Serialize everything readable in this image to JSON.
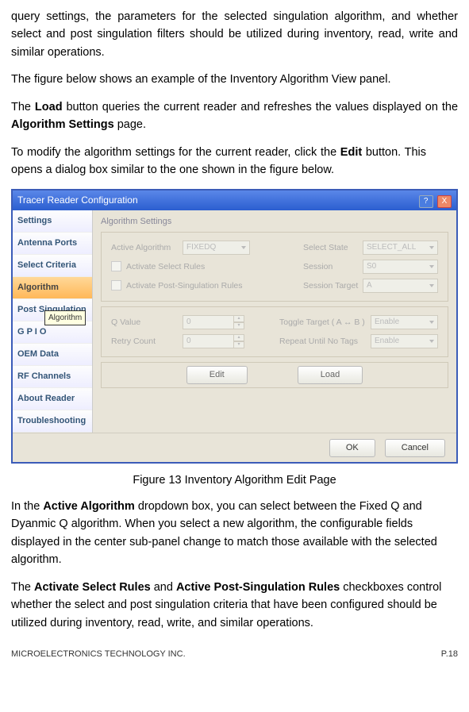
{
  "para1": "query settings, the parameters for the selected singulation algorithm, and whether select and post singulation filters should be utilized during inventory, read, write and similar operations.",
  "para2": "The figure below shows an example of the Inventory Algorithm View panel.",
  "para3a": "The ",
  "para3b": "Load",
  "para3c": " button queries the current reader and refreshes the values displayed on the ",
  "para3d": "Algorithm Settings",
  "para3e": " page.",
  "para4a": "To modify the algorithm settings for the current reader, click the ",
  "para4b": "Edit",
  "para4c": " button. This opens a dialog box similar to the one shown in the figure below.",
  "dlg": {
    "title": "Tracer Reader Configuration",
    "help": "?",
    "close": "X",
    "sidebar": [
      "Settings",
      "Antenna Ports",
      "Select Criteria",
      "Algorithm",
      "Post Singulation",
      "G P I O",
      "OEM Data",
      "RF Channels",
      "About Reader",
      "Troubleshooting"
    ],
    "tooltip": "Algorithm",
    "section": "Algorithm Settings",
    "activeAlg": "Active Algorithm",
    "activeAlgVal": "FIXEDQ",
    "cb1": "Activate Select Rules",
    "cb2": "Activate Post-Singulation Rules",
    "selectState": "Select State",
    "selectStateVal": "SELECT_ALL",
    "session": "Session",
    "sessionVal": "S0",
    "sessionTarget": "Session Target",
    "sessionTargetVal": "A",
    "qvalue": "Q Value",
    "qvalueVal": "0",
    "retry": "Retry Count",
    "retryVal": "0",
    "toggle": "Toggle Target ( A ↔ B )",
    "toggleVal": "Enable",
    "repeat": "Repeat Until No Tags",
    "repeatVal": "Enable",
    "edit": "Edit",
    "load": "Load",
    "ok": "OK",
    "cancel": "Cancel"
  },
  "caption": "Figure 13 Inventory Algorithm Edit Page",
  "para5a": "In the ",
  "para5b": "Active Algorithm",
  "para5c": " dropdown box, you can select between the Fixed Q and Dyanmic Q algorithm. When you select a new algorithm, the configurable fields displayed in the center sub-panel change to match those available with the selected algorithm.",
  "para6a": "The ",
  "para6b": "Activate Select Rules",
  "para6c": " and ",
  "para6d": "Active Post-Singulation Rules",
  "para6e": " checkboxes control whether the select and post singulation criteria that have been configured should be utilized during inventory, read, write, and similar operations.",
  "footerLeft": "MICROELECTRONICS TECHNOLOGY INC.",
  "footerRight": "P.18"
}
